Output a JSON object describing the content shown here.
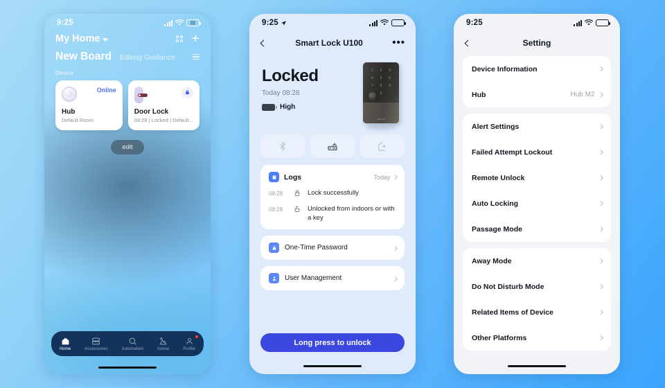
{
  "phone1": {
    "status": {
      "time": "9:25",
      "battery": "84",
      "signal_icon": "cellular-bars-icon",
      "wifi_icon": "wifi-icon"
    },
    "header": {
      "home_name": "My Home",
      "caret_icon": "chevron-down-icon",
      "scan_icon": "grid-dots-icon",
      "add_icon": "plus-icon"
    },
    "board": {
      "name": "New Board",
      "guidance": "Editing Guidance",
      "menu_icon": "hamburger-icon"
    },
    "section_label": "Device",
    "devices": [
      {
        "name": "Hub",
        "status": "Online",
        "subtitle": "Default Room",
        "icon": "hub-device-icon"
      },
      {
        "name": "Door Lock",
        "status": "",
        "subtitle": "08:28 | Locked | Default...",
        "icon": "door-lock-device-icon",
        "badge_icon": "lock-closed-icon"
      }
    ],
    "edit_button": "edit",
    "tabs": [
      {
        "label": "Home",
        "icon": "home-icon",
        "active": true,
        "badge": false
      },
      {
        "label": "Accessories",
        "icon": "accessories-icon",
        "active": false,
        "badge": false
      },
      {
        "label": "Automation",
        "icon": "automation-icon",
        "active": false,
        "badge": false
      },
      {
        "label": "Scene",
        "icon": "scene-icon",
        "active": false,
        "badge": false
      },
      {
        "label": "Profile",
        "icon": "profile-icon",
        "active": false,
        "badge": true
      }
    ]
  },
  "phone2": {
    "status": {
      "time": "9:25",
      "battery": "84",
      "location_icon": "location-arrow-icon"
    },
    "nav": {
      "back_icon": "chevron-left-icon",
      "title": "Smart Lock U100",
      "more_icon": "ellipsis-icon"
    },
    "hero": {
      "state": "Locked",
      "timestamp": "Today 08:28",
      "battery_level": "High",
      "battery_icon": "battery-icon",
      "device_image": "smart-lock-keypad-image",
      "keypad_digits": [
        "1",
        "2",
        "3",
        "4",
        "5",
        "6",
        "7",
        "8",
        "9",
        "0"
      ],
      "brand": "Aqara"
    },
    "actions": [
      {
        "icon": "bluetooth-icon",
        "enabled": false
      },
      {
        "icon": "hub-wireless-icon",
        "enabled": true
      },
      {
        "icon": "away-home-icon",
        "enabled": false
      }
    ],
    "logs": {
      "icon": "logs-icon",
      "title": "Logs",
      "range": "Today",
      "chevron_icon": "chevron-right-icon",
      "entries": [
        {
          "time": "08:28",
          "icon": "lock-closed-icon",
          "text": "Lock successfully"
        },
        {
          "time": "08:28",
          "icon": "lock-open-icon",
          "text": "Unlocked from indoors or with a key"
        }
      ]
    },
    "rows": [
      {
        "label": "One-Time Password",
        "icon": "password-lock-icon"
      },
      {
        "label": "User Management",
        "icon": "user-icon"
      }
    ],
    "primary_button": "Long press to unlock"
  },
  "phone3": {
    "status": {
      "time": "9:25",
      "battery": "84"
    },
    "nav": {
      "back_icon": "chevron-left-icon",
      "title": "Setting"
    },
    "groups": [
      [
        {
          "label": "Device Information",
          "value": ""
        },
        {
          "label": "Hub",
          "value": "Hub M2"
        }
      ],
      [
        {
          "label": "Alert Settings",
          "value": ""
        },
        {
          "label": "Failed Attempt Lockout",
          "value": ""
        },
        {
          "label": "Remote Unlock",
          "value": ""
        },
        {
          "label": "Auto Locking",
          "value": ""
        },
        {
          "label": "Passage Mode",
          "value": ""
        }
      ],
      [
        {
          "label": "Away Mode",
          "value": ""
        },
        {
          "label": "Do Not Disturb Mode",
          "value": ""
        },
        {
          "label": "Related Items of Device",
          "value": ""
        },
        {
          "label": "Other Platforms",
          "value": ""
        }
      ]
    ]
  },
  "colors": {
    "page_background_light": "#a7dcf7",
    "page_background_dark": "#3aa4fd",
    "accent_blue": "#3a48e0",
    "online_blue": "#4e6ef5",
    "tabbar_navy": "#14335c",
    "badge_red": "#ff3b30"
  }
}
